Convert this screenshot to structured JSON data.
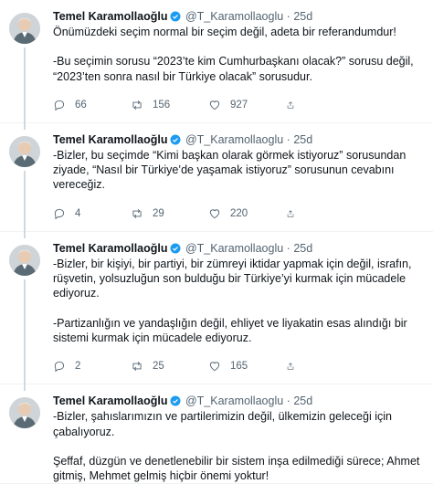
{
  "author": {
    "name": "Temel Karamollaoğlu",
    "handle": "@T_Karamollaoglu",
    "separator": "·"
  },
  "tweets": [
    {
      "time": "25d",
      "paragraphs": [
        "Önümüzdeki seçim normal bir seçim değil, adeta bir referandumdur!",
        "-Bu seçimin sorusu “2023’te kim Cumhurbaşkanı olacak?” sorusu değil,\n“2023’ten sonra nasıl bir Türkiye olacak” sorusudur."
      ],
      "replies": "66",
      "retweets": "156",
      "likes": "927"
    },
    {
      "time": "25d",
      "paragraphs": [
        "-Bizler, bu seçimde “Kimi başkan olarak görmek istiyoruz” sorusundan\nziyade, “Nasıl bir Türkiye’de yaşamak istiyoruz” sorusunun cevabını\nvereceğiz."
      ],
      "replies": "4",
      "retweets": "29",
      "likes": "220"
    },
    {
      "time": "25d",
      "paragraphs": [
        "-Bizler, bir kişiyi, bir partiyi, bir zümreyi iktidar yapmak için değil, israfın,\nrüşvetin, yolsuzluğun son bulduğu bir Türkiye’yi kurmak için mücadele\nediyoruz.",
        "-Partizanlığın ve yandaşlığın değil, ehliyet ve liyakatin esas alındığı bir\nsistemi kurmak için mücadele ediyoruz."
      ],
      "replies": "2",
      "retweets": "25",
      "likes": "165"
    },
    {
      "time": "25d",
      "paragraphs": [
        "-Bizler, şahıslarımızın ve partilerimizin değil, ülkemizin geleceği için\nçabalıyoruz.",
        "Şeffaf, düzgün ve denetlenebilir bir sistem inşa edilmediği sürece; Ahmet\ngitmiş, Mehmet gelmiş hiçbir önemi yoktur!"
      ]
    }
  ],
  "icons": {
    "avatar": "profile-photo",
    "verified": "verified-badge-icon",
    "reply": "reply-icon",
    "retweet": "retweet-icon",
    "like": "like-icon",
    "share": "share-icon"
  },
  "colors": {
    "text": "#0f1419",
    "secondary": "#536471",
    "verified": "#1d9bf0",
    "divider": "#eff3f4",
    "thread": "#cfd9de"
  }
}
